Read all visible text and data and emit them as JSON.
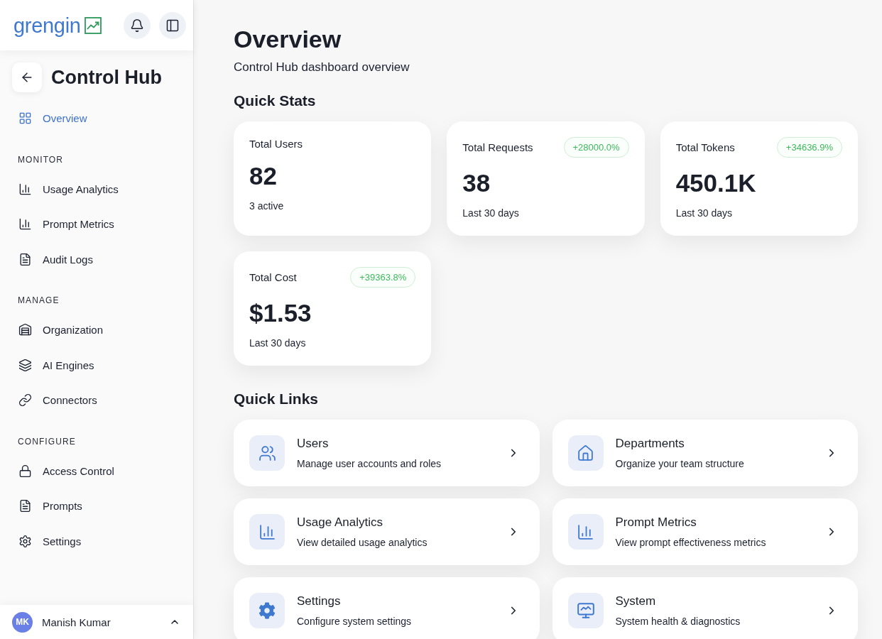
{
  "sidebar": {
    "logo": "grengin",
    "title": "Control Hub",
    "groups": [
      {
        "items": [
          {
            "label": "Overview",
            "selected": true
          }
        ]
      },
      {
        "heading": "MONITOR",
        "items": [
          {
            "label": "Usage Analytics",
            "selected": false
          },
          {
            "label": "Prompt Metrics",
            "selected": false
          },
          {
            "label": "Audit Logs",
            "selected": false
          }
        ]
      },
      {
        "heading": "MANAGE",
        "items": [
          {
            "label": "Organization",
            "selected": false
          },
          {
            "label": "AI Engines",
            "selected": false
          },
          {
            "label": "Connectors",
            "selected": false
          }
        ]
      },
      {
        "heading": "CONFIGURE",
        "items": [
          {
            "label": "Access Control",
            "selected": false
          },
          {
            "label": "Prompts",
            "selected": false
          },
          {
            "label": "Settings",
            "selected": false
          }
        ]
      }
    ],
    "user": {
      "initials": "MK",
      "name": "Manish Kumar"
    }
  },
  "page": {
    "title": "Overview",
    "subtitle": "Control Hub dashboard overview"
  },
  "quick_stats": {
    "heading": "Quick Stats",
    "cards": [
      {
        "label": "Total Users",
        "value": "82",
        "note": "3 active"
      },
      {
        "label": "Total Requests",
        "badge": "+28000.0%",
        "value": "38",
        "note": "Last 30 days"
      },
      {
        "label": "Total Tokens",
        "badge": "+34636.9%",
        "value": "450.1K",
        "note": "Last 30 days"
      },
      {
        "label": "Total Cost",
        "badge": "+39363.8%",
        "value": "$1.53",
        "note": "Last 30 days"
      }
    ]
  },
  "quick_links": {
    "heading": "Quick Links",
    "items": [
      {
        "title": "Users",
        "description": "Manage user accounts and roles"
      },
      {
        "title": "Departments",
        "description": "Organize your team structure"
      },
      {
        "title": "Usage Analytics",
        "description": "View detailed usage analytics"
      },
      {
        "title": "Prompt Metrics",
        "description": "View prompt effectiveness metrics"
      },
      {
        "title": "Settings",
        "description": "Configure system settings"
      },
      {
        "title": "System",
        "description": "System health & diagnostics"
      }
    ]
  }
}
